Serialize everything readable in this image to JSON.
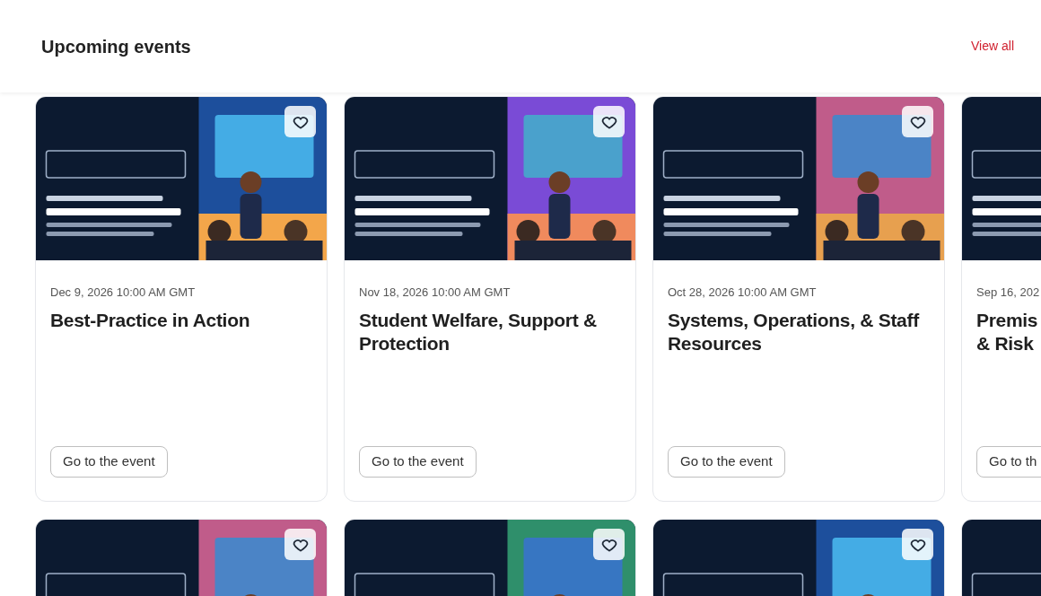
{
  "header": {
    "title": "Upcoming events",
    "link": "View all"
  },
  "rows": [
    [
      {
        "date": "Dec 9, 2026 10:00 AM GMT",
        "title": "Best-Practice in Action",
        "button": "Go to the event",
        "favorite": false
      },
      {
        "date": "Nov 18, 2026 10:00 AM GMT",
        "title": "Student Welfare, Support & Protection",
        "button": "Go to the event",
        "favorite": false
      },
      {
        "date": "Oct 28, 2026 10:00 AM GMT",
        "title": "Systems, Operations, & Staff Resources",
        "button": "Go to the event",
        "favorite": false
      },
      {
        "date": "Sep 16, 202",
        "title": "Premis\n& Risk",
        "button": "Go to th"
      }
    ],
    [
      {
        "favorite": false
      },
      {
        "favorite": false
      },
      {
        "favorite": false
      },
      {}
    ]
  ]
}
